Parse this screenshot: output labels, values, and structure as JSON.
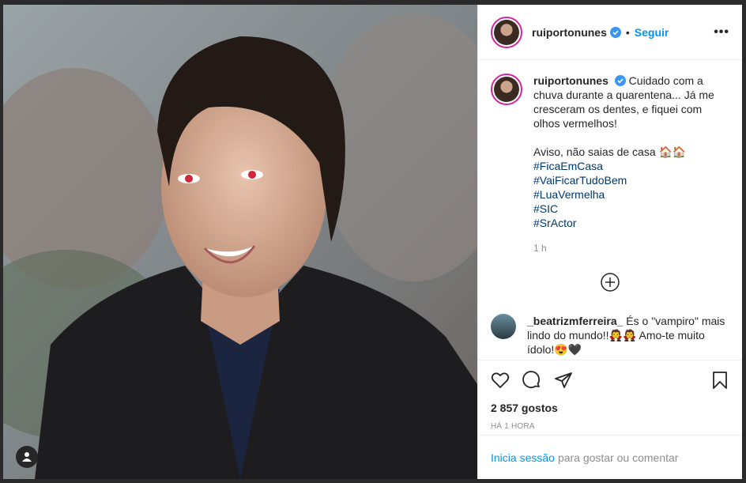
{
  "post": {
    "username": "ruiportonunes",
    "dot": "•",
    "follow_label": "Seguir",
    "more_label": "•••"
  },
  "caption": {
    "username": "ruiportonunes",
    "text": "Cuidado com a chuva durante a quarentena... Já me cresceram os dentes, e fiquei com olhos vermelhos!",
    "line2": "Aviso, não saias de casa 🏠🏠",
    "hashtags": [
      "#FicaEmCasa",
      "#VaiFicarTudoBem",
      "#LuaVermelha",
      "#SIC",
      "#SrActor"
    ],
    "time": "1 h"
  },
  "comment": {
    "username": "_beatrizmferreira_",
    "text": "És o \"vampiro\" mais lindo do mundo!!🧛🧛 Amo-te muito ídolo!😍🖤"
  },
  "stats": {
    "likes": "2 857 gostos",
    "ago": "HÁ 1 HORA"
  },
  "login": {
    "link": "Inicia sessão",
    "rest": "para gostar ou comentar"
  },
  "colors": {
    "accent": "#0095f6",
    "verified": "#3897f0",
    "hashtag": "#00376b"
  }
}
